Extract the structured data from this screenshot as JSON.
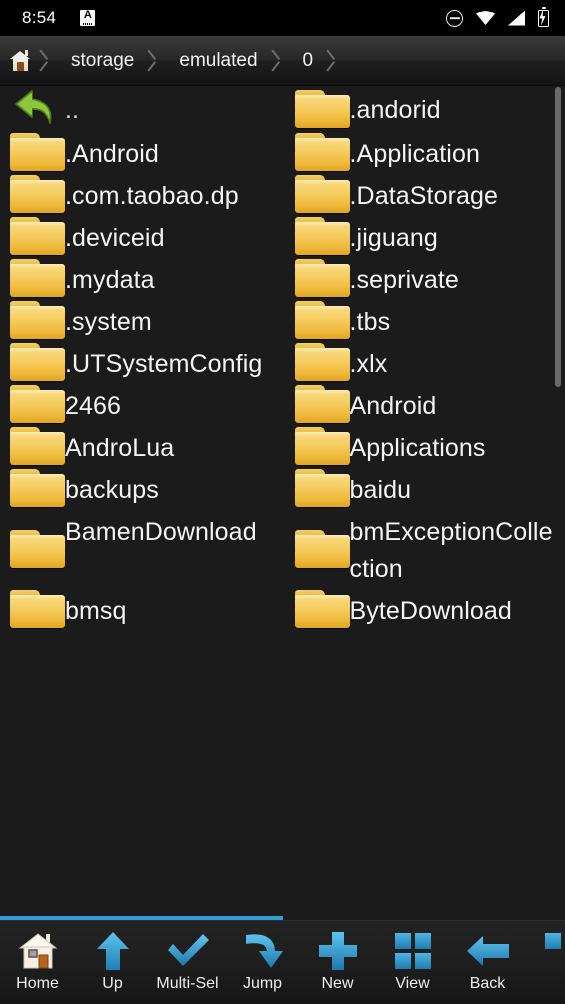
{
  "statusbar": {
    "time": "8:54",
    "app_badge": "A",
    "icons": [
      "do-not-disturb-icon",
      "wifi-icon",
      "signal-icon",
      "battery-charging-icon"
    ]
  },
  "breadcrumb": {
    "home_icon": "home-icon",
    "segments": [
      "storage",
      "emulated",
      "0"
    ]
  },
  "theme": {
    "background": "#1b1b1b",
    "text": "#f4f4f4",
    "accent": "#2e9fd4",
    "folder_light": "#f9dd86",
    "folder_dark": "#e0a524",
    "statusbar_bg": "#000000"
  },
  "file_list": {
    "scrollbar": {
      "visible": true,
      "top_pct": 0,
      "height_pct": 36
    },
    "progress": {
      "visible": true,
      "percent": 50,
      "color": "#2e9fd4"
    },
    "rows": [
      {
        "left": {
          "name": "..",
          "icon": "back-arrow-icon"
        },
        "right": {
          "name": ".andorid",
          "icon": "folder-icon"
        }
      },
      {
        "left": {
          "name": ".Android",
          "icon": "folder-icon"
        },
        "right": {
          "name": ".Application",
          "icon": "folder-icon"
        }
      },
      {
        "left": {
          "name": ".com.taobao.dp",
          "icon": "folder-icon"
        },
        "right": {
          "name": ".DataStorage",
          "icon": "folder-icon"
        }
      },
      {
        "left": {
          "name": ".deviceid",
          "icon": "folder-icon"
        },
        "right": {
          "name": ".jiguang",
          "icon": "folder-icon"
        }
      },
      {
        "left": {
          "name": ".mydata",
          "icon": "folder-icon"
        },
        "right": {
          "name": ".seprivate",
          "icon": "folder-icon"
        }
      },
      {
        "left": {
          "name": ".system",
          "icon": "folder-icon"
        },
        "right": {
          "name": ".tbs",
          "icon": "folder-icon"
        }
      },
      {
        "left": {
          "name": ".UTSystemConfig",
          "icon": "folder-icon"
        },
        "right": {
          "name": ".xlx",
          "icon": "folder-icon"
        }
      },
      {
        "left": {
          "name": "2466",
          "icon": "folder-icon"
        },
        "right": {
          "name": "Android",
          "icon": "folder-icon"
        }
      },
      {
        "left": {
          "name": "AndroLua",
          "icon": "folder-icon"
        },
        "right": {
          "name": "Applications",
          "icon": "folder-icon"
        }
      },
      {
        "left": {
          "name": "backups",
          "icon": "folder-icon"
        },
        "right": {
          "name": "baidu",
          "icon": "folder-icon"
        }
      },
      {
        "left": {
          "name": "BamenDownload",
          "icon": "folder-icon"
        },
        "right": {
          "name": "bmExceptionCollection",
          "icon": "folder-icon"
        }
      },
      {
        "left": {
          "name": "bmsq",
          "icon": "folder-icon"
        },
        "right": {
          "name": "ByteDownload",
          "icon": "folder-icon"
        }
      }
    ]
  },
  "toolbar": {
    "buttons": [
      {
        "label": "Home",
        "icon": "home-icon"
      },
      {
        "label": "Up",
        "icon": "arrow-up-icon"
      },
      {
        "label": "Multi-Sel",
        "icon": "checkmark-icon"
      },
      {
        "label": "Jump",
        "icon": "curved-arrow-icon"
      },
      {
        "label": "New",
        "icon": "plus-icon"
      },
      {
        "label": "View",
        "icon": "grid-icon"
      },
      {
        "label": "Back",
        "icon": "arrow-left-icon"
      },
      {
        "label": "",
        "icon": "grid-icon-partial"
      }
    ]
  }
}
